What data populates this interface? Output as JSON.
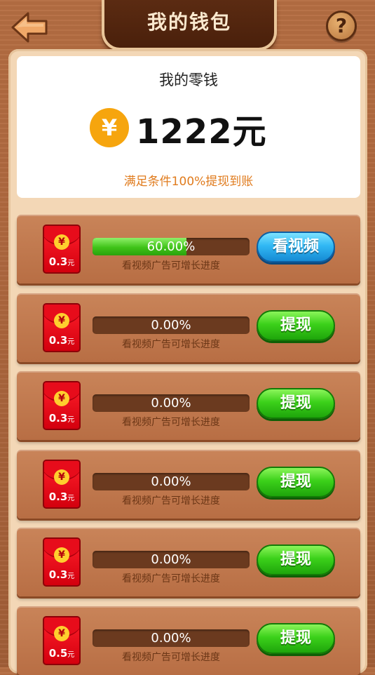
{
  "header": {
    "title": "我的钱包",
    "help_label": "?"
  },
  "wallet": {
    "label": "我的零钱",
    "currency_symbol": "¥",
    "amount": "1222元",
    "note": "满足条件100%提现到账"
  },
  "rows": [
    {
      "envelope_value": "0.3",
      "envelope_unit": "元",
      "progress": 0.6,
      "progress_text": "60.00%",
      "hint": "看视频广告可增长进度",
      "button": "看视频",
      "button_color": "#31b8f4"
    },
    {
      "envelope_value": "0.3",
      "envelope_unit": "元",
      "progress": 0.0,
      "progress_text": "0.00%",
      "hint": "看视频广告可增长进度",
      "button": "提现",
      "button_color": "#3cd11a"
    },
    {
      "envelope_value": "0.3",
      "envelope_unit": "元",
      "progress": 0.0,
      "progress_text": "0.00%",
      "hint": "看视频广告可增长进度",
      "button": "提现",
      "button_color": "#3cd11a"
    },
    {
      "envelope_value": "0.3",
      "envelope_unit": "元",
      "progress": 0.0,
      "progress_text": "0.00%",
      "hint": "看视频广告可增长进度",
      "button": "提现",
      "button_color": "#3cd11a"
    },
    {
      "envelope_value": "0.3",
      "envelope_unit": "元",
      "progress": 0.0,
      "progress_text": "0.00%",
      "hint": "看视频广告可增长进度",
      "button": "提现",
      "button_color": "#3cd11a"
    },
    {
      "envelope_value": "0.5",
      "envelope_unit": "元",
      "progress": 0.0,
      "progress_text": "0.00%",
      "hint": "看视频广告可增长进度",
      "button": "提现",
      "button_color": "#3cd11a"
    }
  ],
  "icons": {
    "back": "back-arrow-icon",
    "help": "help-icon",
    "coin": "yuan-coin-icon",
    "envelope": "red-envelope-icon",
    "envelope_seal": "¥"
  }
}
